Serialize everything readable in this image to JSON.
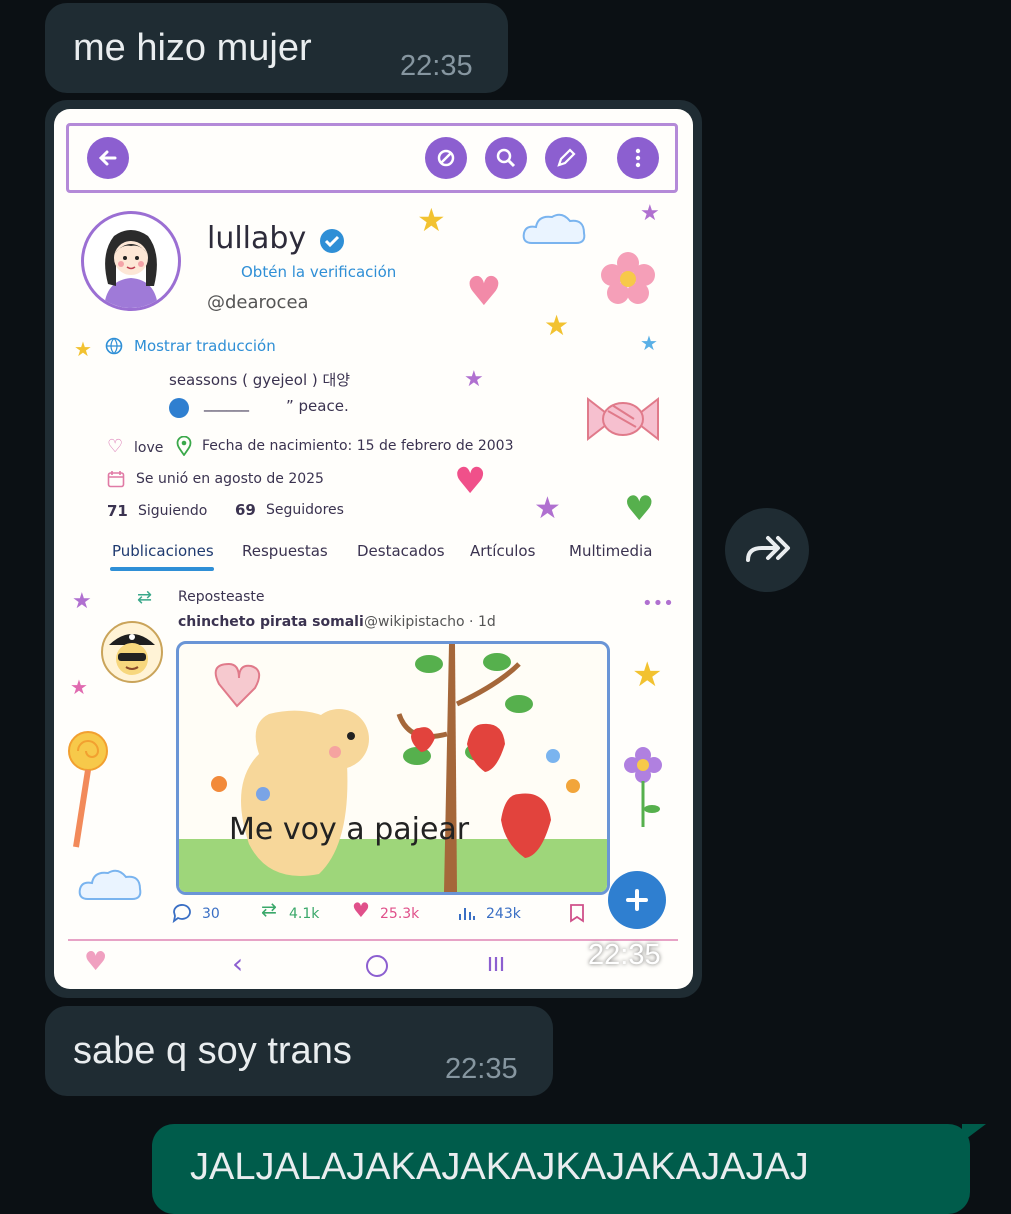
{
  "messages": {
    "msg1": {
      "text": "me hizo mujer",
      "time": "22:35"
    },
    "image_msg": {
      "time": "22:35"
    },
    "msg2": {
      "text": "sabe q soy trans",
      "time": "22:35"
    },
    "msg3": {
      "text": "JALJALAJAKAJAKAJKAJAKAJAJAJ"
    }
  },
  "profile": {
    "name": "lullaby",
    "verify_link": "Obtén la verificación",
    "handle": "@dearocea",
    "translate": "Mostrar traducción",
    "bio_line1": "seassons ( gyejeol ) 대양",
    "bio_line2_blank": "______",
    "bio_line2_text": "” peace.",
    "love": "love",
    "birthday": "Fecha de nacimiento: 15 de febrero de 2003",
    "joined": "Se unió en agosto de 2025",
    "following_count": "71",
    "following_label": "Siguiendo",
    "followers_count": "69",
    "followers_label": "Seguidores"
  },
  "tabs": [
    "Publicaciones",
    "Respuestas",
    "Destacados",
    "Artículos",
    "Multimedia"
  ],
  "post": {
    "repost_label": "Reposteaste",
    "author": "chincheto pirata somali",
    "author_handle": "@wikipistacho · 1d",
    "image_caption": "Me voy a pajear",
    "replies": "30",
    "reposts": "4.1k",
    "likes": "25.3k",
    "views": "243k"
  },
  "icons": {
    "back": "arrow-left-icon",
    "mute": "slash-circle-icon",
    "search": "search-icon",
    "edit": "pencil-icon",
    "more": "more-vertical-icon",
    "forward": "forward-icon",
    "compose": "plus-icon"
  },
  "colors": {
    "chat_bg": "#0b1014",
    "incoming_bubble": "#1f2c33",
    "outgoing_bubble": "#005c4b",
    "accent_purple": "#8c5fd0",
    "link_blue": "#2f8fd6"
  }
}
